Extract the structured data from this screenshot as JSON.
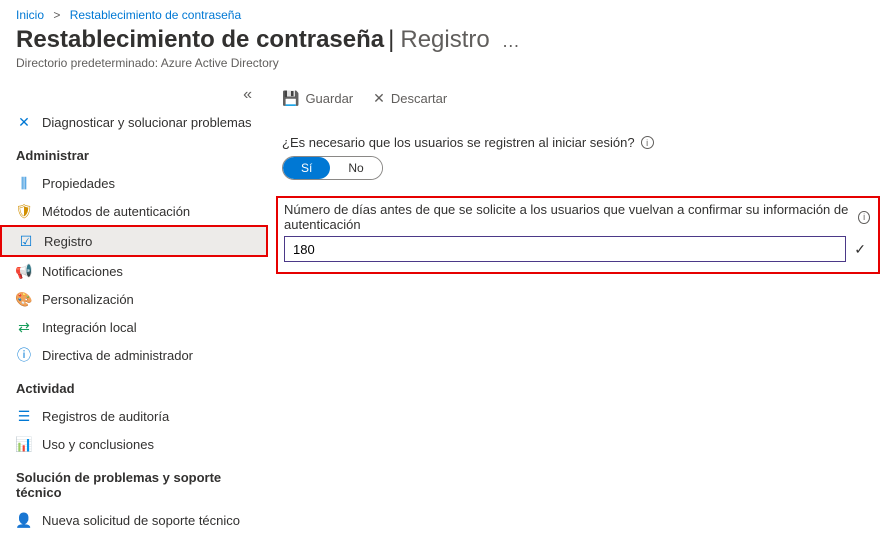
{
  "breadcrumb": {
    "home": "Inicio",
    "current": "Restablecimiento de contraseña"
  },
  "header": {
    "title": "Restablecimiento de contraseña",
    "section": "Registro",
    "subtitle": "Directorio predeterminado: Azure Active Directory"
  },
  "sidebar": {
    "diagnose": "Diagnosticar y solucionar problemas",
    "sections": {
      "manage": "Administrar",
      "activity": "Actividad",
      "support": "Solución de problemas y soporte técnico"
    },
    "manage_items": [
      {
        "label": "Propiedades"
      },
      {
        "label": "Métodos de autenticación"
      },
      {
        "label": "Registro"
      },
      {
        "label": "Notificaciones"
      },
      {
        "label": "Personalización"
      },
      {
        "label": "Integración local"
      },
      {
        "label": "Directiva de administrador"
      }
    ],
    "activity_items": [
      {
        "label": "Registros de auditoría"
      },
      {
        "label": "Uso y conclusiones"
      }
    ],
    "support_items": [
      {
        "label": "Nueva solicitud de soporte técnico"
      }
    ]
  },
  "toolbar": {
    "save": "Guardar",
    "discard": "Descartar"
  },
  "form": {
    "require_register_label": "¿Es necesario que los usuarios se registren al iniciar sesión?",
    "yes": "Sí",
    "no": "No",
    "days_label": "Número de días antes de que se solicite a los usuarios que vuelvan a confirmar su información de autenticación",
    "days_value": "180"
  }
}
